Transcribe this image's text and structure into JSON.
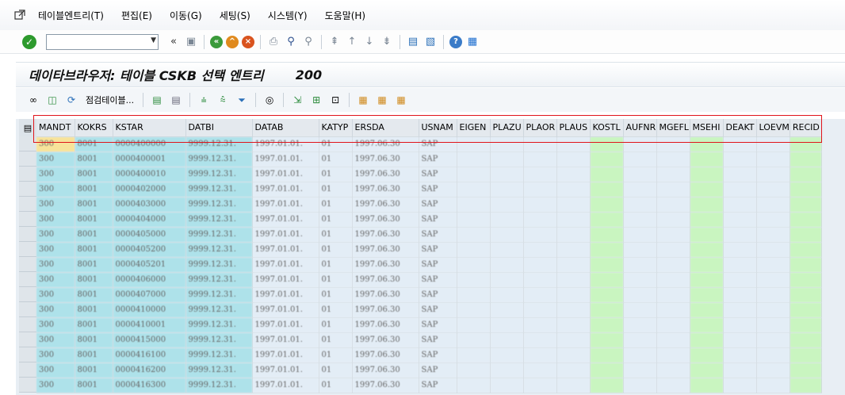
{
  "menu": {
    "items": [
      "테이블엔트리(T)",
      "편집(E)",
      "이동(G)",
      "세팅(S)",
      "시스템(Y)",
      "도움말(H)"
    ]
  },
  "toolbar": {
    "command_value": "",
    "back_glyph": "«"
  },
  "title": {
    "text": "데이타브라우저: 테이블 CSKB 선택 엔트리",
    "count": "200"
  },
  "app_toolbar": {
    "check_table_label": "점검테이블..."
  },
  "grid": {
    "columns": [
      "MANDT",
      "KOKRS",
      "KSTAR",
      "DATBI",
      "DATAB",
      "KATYP",
      "ERSDA",
      "USNAM",
      "EIGEN",
      "PLAZU",
      "PLAOR",
      "PLAUS",
      "KOSTL",
      "AUFNR",
      "MGEFL",
      "MSEHI",
      "DEAKT",
      "LOEVM",
      "RECID"
    ],
    "rows": [
      [
        "300",
        "8001",
        "0000400000",
        "9999.12.31.",
        "1997.01.01.",
        "01",
        "1997.06.30",
        "SAP"
      ],
      [
        "300",
        "8001",
        "0000400001",
        "9999.12.31.",
        "1997.01.01.",
        "01",
        "1997.06.30",
        "SAP"
      ],
      [
        "300",
        "8001",
        "0000400010",
        "9999.12.31.",
        "1997.01.01.",
        "01",
        "1997.06.30",
        "SAP"
      ],
      [
        "300",
        "8001",
        "0000402000",
        "9999.12.31.",
        "1997.01.01.",
        "01",
        "1997.06.30",
        "SAP"
      ],
      [
        "300",
        "8001",
        "0000403000",
        "9999.12.31.",
        "1997.01.01.",
        "01",
        "1997.06.30",
        "SAP"
      ],
      [
        "300",
        "8001",
        "0000404000",
        "9999.12.31.",
        "1997.01.01.",
        "01",
        "1997.06.30",
        "SAP"
      ],
      [
        "300",
        "8001",
        "0000405000",
        "9999.12.31.",
        "1997.01.01.",
        "01",
        "1997.06.30",
        "SAP"
      ],
      [
        "300",
        "8001",
        "0000405200",
        "9999.12.31.",
        "1997.01.01.",
        "01",
        "1997.06.30",
        "SAP"
      ],
      [
        "300",
        "8001",
        "0000405201",
        "9999.12.31.",
        "1997.01.01.",
        "01",
        "1997.06.30",
        "SAP"
      ],
      [
        "300",
        "8001",
        "0000406000",
        "9999.12.31.",
        "1997.01.01.",
        "01",
        "1997.06.30",
        "SAP"
      ],
      [
        "300",
        "8001",
        "0000407000",
        "9999.12.31.",
        "1997.01.01.",
        "01",
        "1997.06.30",
        "SAP"
      ],
      [
        "300",
        "8001",
        "0000410000",
        "9999.12.31.",
        "1997.01.01.",
        "01",
        "1997.06.30",
        "SAP"
      ],
      [
        "300",
        "8001",
        "0000410001",
        "9999.12.31.",
        "1997.01.01.",
        "01",
        "1997.06.30",
        "SAP"
      ],
      [
        "300",
        "8001",
        "0000415000",
        "9999.12.31.",
        "1997.01.01.",
        "01",
        "1997.06.30",
        "SAP"
      ],
      [
        "300",
        "8001",
        "0000416100",
        "9999.12.31.",
        "1997.01.01.",
        "01",
        "1997.06.30",
        "SAP"
      ],
      [
        "300",
        "8001",
        "0000416200",
        "9999.12.31.",
        "1997.01.01.",
        "01",
        "1997.06.30",
        "SAP"
      ],
      [
        "300",
        "8001",
        "0000416300",
        "9999.12.31.",
        "1997.01.01.",
        "01",
        "1997.06.30",
        "SAP"
      ]
    ]
  },
  "colors": {
    "key_col": "#aee2ea",
    "green_col": "#c9f5c0",
    "highlight": "#e0141b"
  }
}
